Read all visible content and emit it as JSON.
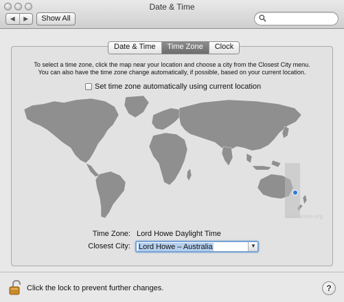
{
  "window": {
    "title": "Date & Time"
  },
  "toolbar": {
    "back_glyph": "◀",
    "forward_glyph": "▶",
    "show_all_label": "Show All",
    "search_placeholder": "",
    "search_icon": "magnifier-icon"
  },
  "tabs": [
    {
      "label": "Date & Time",
      "active": false
    },
    {
      "label": "Time Zone",
      "active": true
    },
    {
      "label": "Clock",
      "active": false
    }
  ],
  "timezone": {
    "instructions_line1": "To select a time zone, click the map near your location and choose a city from the Closest City menu.",
    "instructions_line2": "You can also have the time zone change automatically, if possible, based on your current location.",
    "auto_label": "Set time zone automatically using current location",
    "auto_checked": false,
    "map_credit": "Geonames.org",
    "time_zone_label": "Time Zone:",
    "time_zone_value": "Lord Howe Daylight Time",
    "closest_city_label": "Closest City:",
    "closest_city_value": "Lord Howe – Australia"
  },
  "footer": {
    "lock_label": "Click the lock to prevent further changes.",
    "lock_icon": "unlocked-padlock-icon",
    "help_label": "?"
  },
  "colors": {
    "accent_selection": "#b5cfee",
    "focus_ring": "#7aa3d3",
    "location_pin": "#2f7ddb",
    "land": "#8f8f8f",
    "highlight_zone": "#b9b9b9"
  }
}
